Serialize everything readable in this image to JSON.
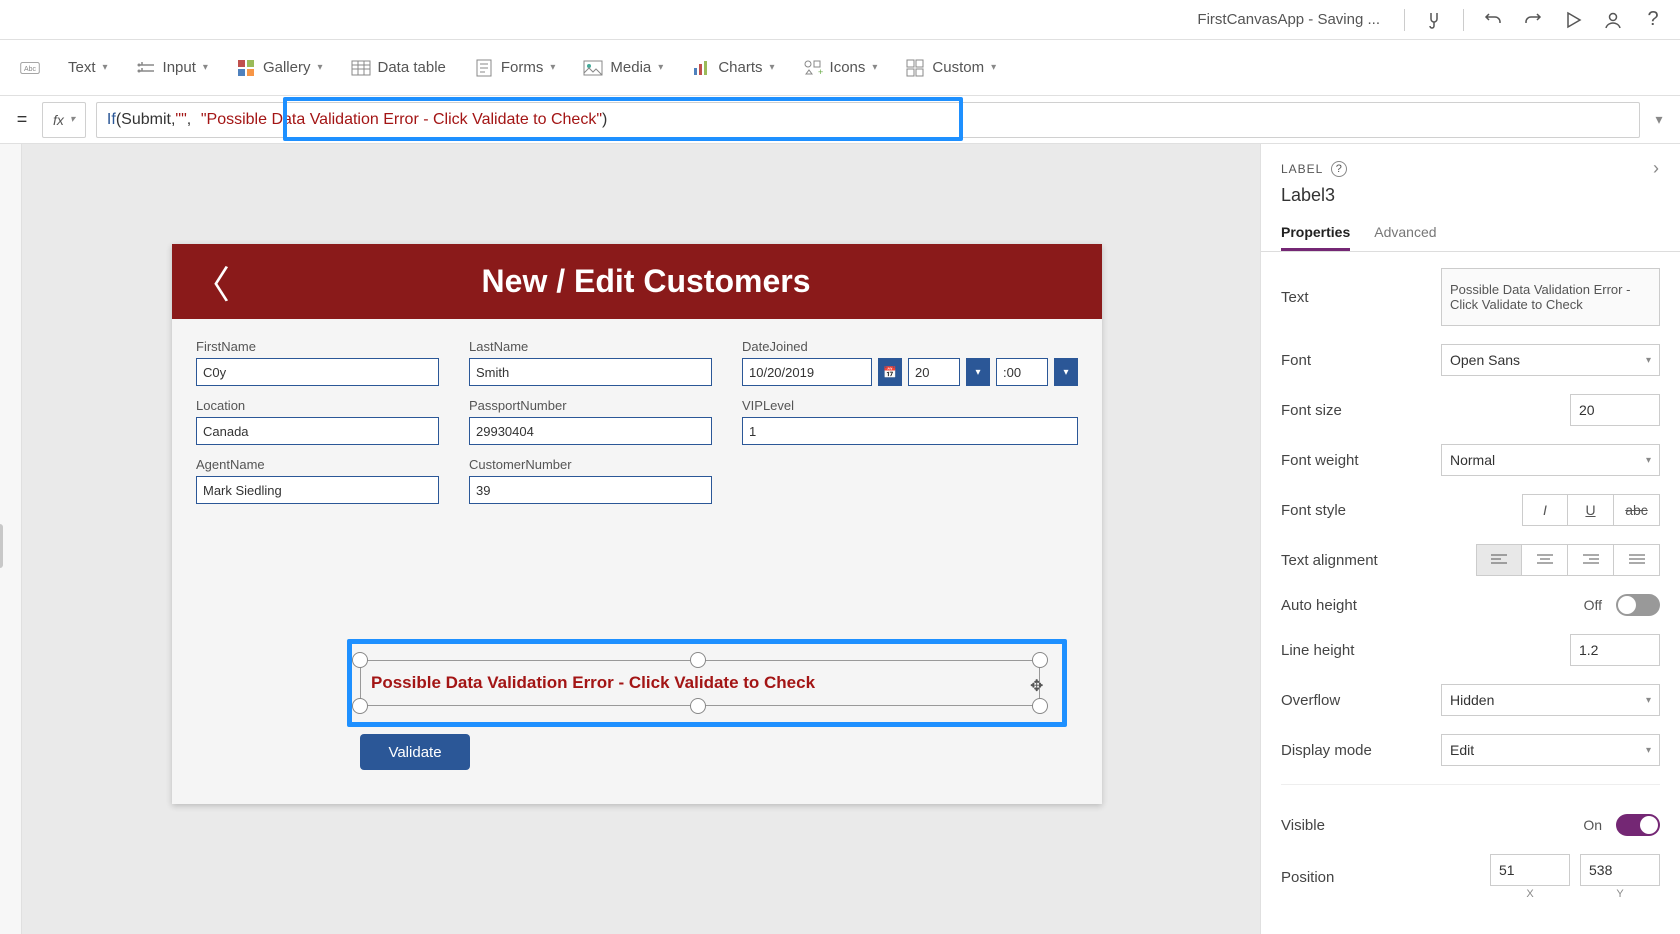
{
  "titlebar": {
    "app_title": "FirstCanvasApp - Saving ..."
  },
  "ribbon": {
    "text": "Text",
    "input": "Input",
    "gallery": "Gallery",
    "datatable": "Data table",
    "forms": "Forms",
    "media": "Media",
    "charts": "Charts",
    "icons": "Icons",
    "custom": "Custom"
  },
  "formula": {
    "eq": "=",
    "fx": "fx",
    "expr_if": "If",
    "expr_open": "(",
    "expr_var": "Submit",
    "expr_c1": ", ",
    "expr_s1": "\"\"",
    "expr_c2": ",",
    "expr_s2": "\"Possible Data Validation Error - Click Validate to Check\"",
    "expr_close": ")"
  },
  "canvas": {
    "title": "New / Edit Customers",
    "fields": {
      "first": {
        "label": "FirstName",
        "value": "C0y"
      },
      "last": {
        "label": "LastName",
        "value": "Smith"
      },
      "djoined": {
        "label": "DateJoined",
        "value": "10/20/2019",
        "hh": "20",
        "mm": "00"
      },
      "loc": {
        "label": "Location",
        "value": "Canada"
      },
      "passport": {
        "label": "PassportNumber",
        "value": "29930404"
      },
      "vip": {
        "label": "VIPLevel",
        "value": "1"
      },
      "agent": {
        "label": "AgentName",
        "value": "Mark Siedling"
      },
      "custnum": {
        "label": "CustomerNumber",
        "value": "39"
      }
    },
    "selected_text": "Possible Data Validation Error - Click Validate to Check",
    "validate_btn": "Validate"
  },
  "props": {
    "panel_label": "LABEL",
    "control_name": "Label3",
    "tab_props": "Properties",
    "tab_adv": "Advanced",
    "rows": {
      "text": {
        "label": "Text",
        "value": "Possible Data Validation Error - Click Validate to Check"
      },
      "font": {
        "label": "Font",
        "value": "Open Sans"
      },
      "fontsize": {
        "label": "Font size",
        "value": "20"
      },
      "fontweight": {
        "label": "Font weight",
        "value": "Normal"
      },
      "fontstyle": {
        "label": "Font style"
      },
      "textalign": {
        "label": "Text alignment"
      },
      "autoheight": {
        "label": "Auto height",
        "value": "Off"
      },
      "lineheight": {
        "label": "Line height",
        "value": "1.2"
      },
      "overflow": {
        "label": "Overflow",
        "value": "Hidden"
      },
      "displaymode": {
        "label": "Display mode",
        "value": "Edit"
      },
      "visible": {
        "label": "Visible",
        "value": "On"
      },
      "position": {
        "label": "Position",
        "x": "51",
        "y": "538",
        "xl": "X",
        "yl": "Y"
      }
    }
  }
}
